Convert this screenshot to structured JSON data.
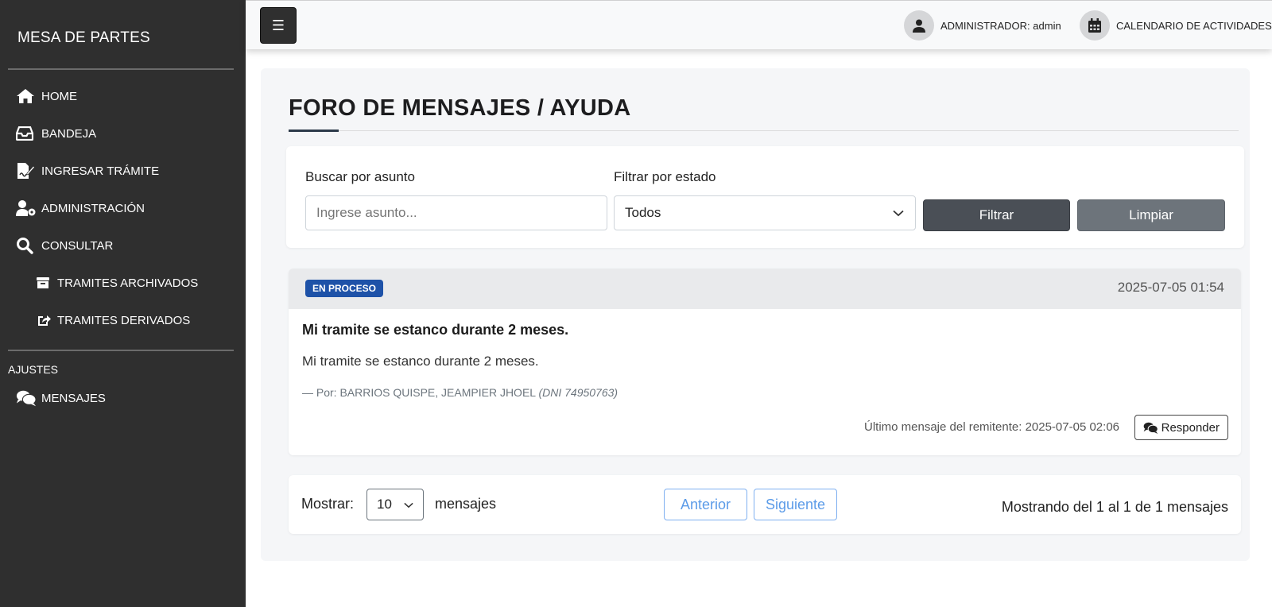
{
  "sidebar": {
    "brand": "MESA DE PARTES",
    "items": [
      {
        "label": "HOME",
        "icon": "home-icon"
      },
      {
        "label": "BANDEJA",
        "icon": "inbox-icon"
      },
      {
        "label": "INGRESAR TRÁMITE",
        "icon": "file-signature-icon"
      },
      {
        "label": "ADMINISTRACIÓN",
        "icon": "user-gear-icon"
      },
      {
        "label": "CONSULTAR",
        "icon": "search-icon"
      },
      {
        "label": "TRAMITES ARCHIVADOS",
        "icon": "archive-icon"
      },
      {
        "label": "TRAMITES DERIVADOS",
        "icon": "share-icon"
      }
    ],
    "section_label": "AJUSTES",
    "settings_items": [
      {
        "label": "MENSAJES",
        "icon": "comments-icon"
      }
    ]
  },
  "topbar": {
    "menu_glyph": "☰",
    "user_label": "ADMINISTRADOR: admin",
    "calendar_label": "CALENDARIO DE ACTIVIDADES"
  },
  "page": {
    "title": "FORO DE MENSAJES / AYUDA"
  },
  "filters": {
    "search_label": "Buscar por asunto",
    "search_placeholder": "Ingrese asunto...",
    "status_label": "Filtrar por estado",
    "status_value": "Todos",
    "filter_button": "Filtrar",
    "clear_button": "Limpiar"
  },
  "message": {
    "status": "EN PROCESO",
    "date": "2025-07-05 01:54",
    "subject": "Mi tramite se estanco durante 2 meses.",
    "body": "Mi tramite se estanco durante 2 meses.",
    "author_prefix": "— Por: BARRIOS QUISPE, JEAMPIER JHOEL",
    "author_dni": "(DNI 74950763)",
    "last_message": "Último mensaje del remitente: 2025-07-05 02:06",
    "reply_button": "Responder"
  },
  "pagination": {
    "show_label": "Mostrar:",
    "page_size": "10",
    "unit_label": "mensajes",
    "prev_button": "Anterior",
    "next_button": "Siguiente",
    "summary": "Mostrando del 1 al 1 de 1 mensajes"
  },
  "colors": {
    "sidebar_bg": "#2f2f2f",
    "badge_blue": "#1e52a8",
    "filter_button": "#4a4f56",
    "clear_button": "#6d747b",
    "pager_blue": "#5b9be8"
  }
}
